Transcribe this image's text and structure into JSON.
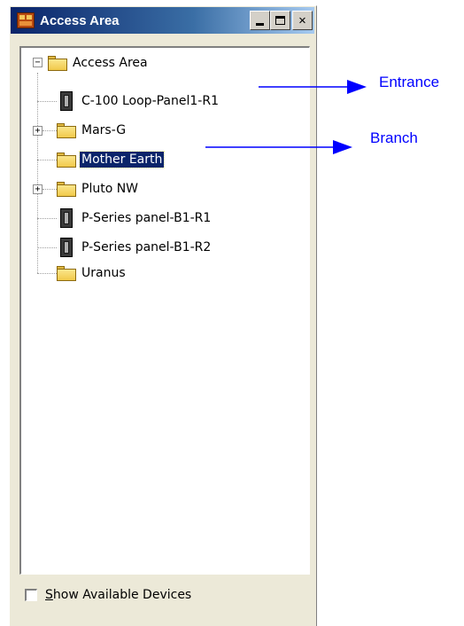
{
  "window": {
    "title": "Access Area",
    "buttons": [
      "minimize",
      "maximize",
      "close"
    ]
  },
  "tree": {
    "root": {
      "label": "Access Area",
      "expander": "−",
      "icon": "folder-icon"
    },
    "items": [
      {
        "label": "C-100 Loop-Panel1-R1",
        "icon": "device-icon",
        "expander": ""
      },
      {
        "label": "Mars-G",
        "icon": "folder-icon",
        "expander": "+"
      },
      {
        "label": "Mother Earth",
        "icon": "folder-icon",
        "expander": "",
        "selected": true
      },
      {
        "label": "Pluto NW",
        "icon": "folder-icon",
        "expander": "+"
      },
      {
        "label": "P-Series panel-B1-R1",
        "icon": "device-icon",
        "expander": ""
      },
      {
        "label": "P-Series panel-B1-R2",
        "icon": "device-icon",
        "expander": ""
      },
      {
        "label": "Uranus",
        "icon": "folder-icon",
        "expander": ""
      }
    ]
  },
  "footer": {
    "checkbox_label": "Show Available Devices",
    "checkbox_checked": false
  },
  "annotations": {
    "entrance": "Entrance",
    "branch": "Branch",
    "color": "#0000ff"
  }
}
